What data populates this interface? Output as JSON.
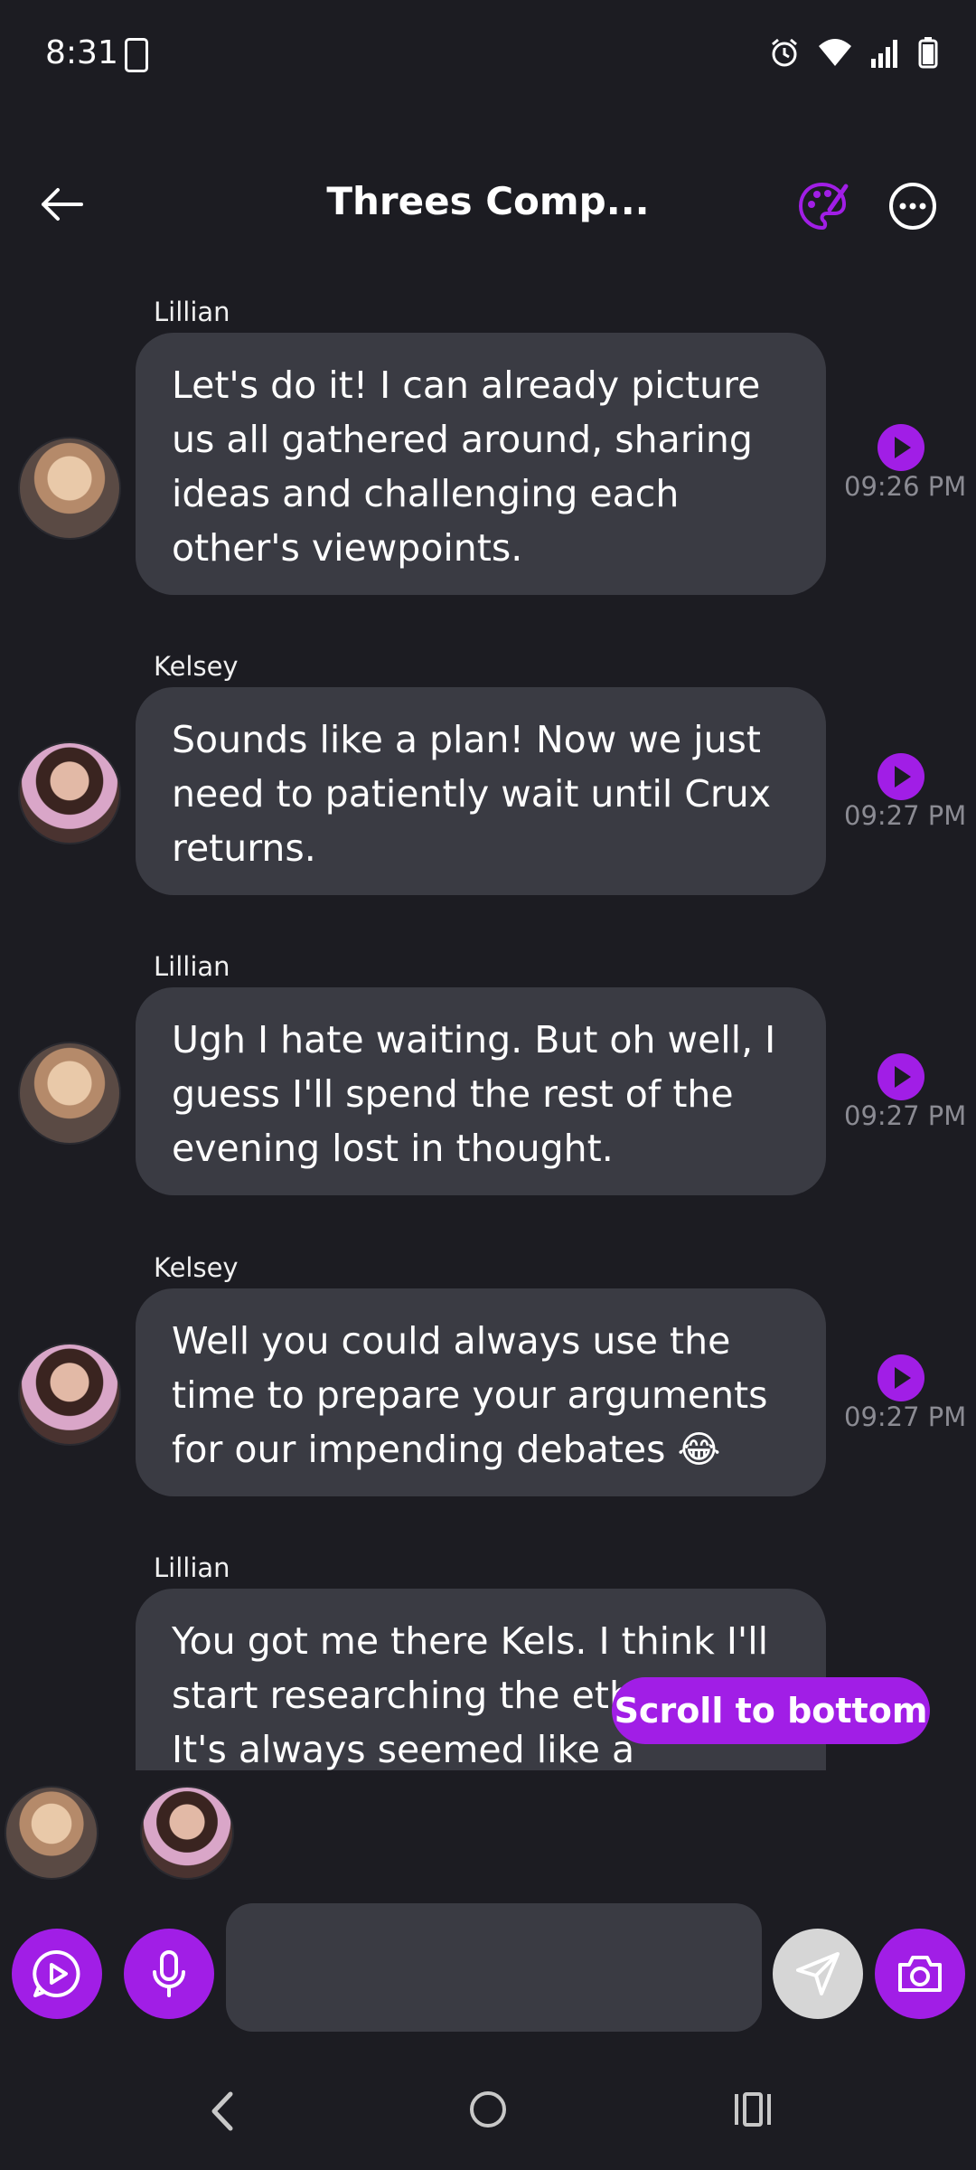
{
  "status_bar": {
    "time": "8:31"
  },
  "header": {
    "title": "Threes Comp..."
  },
  "messages": [
    {
      "sender": "Lillian",
      "text": "Let's do it! I can already picture us all gathered around, sharing ideas and challenging each other's viewpoints.",
      "time": "09:26 PM"
    },
    {
      "sender": "Kelsey",
      "text": "Sounds like a plan! Now we just need to patiently wait until Crux returns.",
      "time": "09:27 PM"
    },
    {
      "sender": "Lillian",
      "text": "Ugh I hate waiting. But oh well, I guess I'll spend the rest of the evening lost in thought.",
      "time": "09:27 PM"
    },
    {
      "sender": "Kelsey",
      "text": "Well you could always use the time to prepare your arguments for our impending debates 😂",
      "time": "09:27 PM"
    },
    {
      "sender": "Lillian",
      "text": "You got me there Kels. I think I'll start researching the ethics of... It's always seemed like a paradox"
    }
  ],
  "scroll_button": {
    "label": "Scroll to bottom"
  },
  "composer": {
    "placeholder": ""
  },
  "colors": {
    "accent": "#a11ee6",
    "background": "#1c1c22",
    "bubble": "#3a3b43",
    "timestamp": "#8b8b93"
  }
}
